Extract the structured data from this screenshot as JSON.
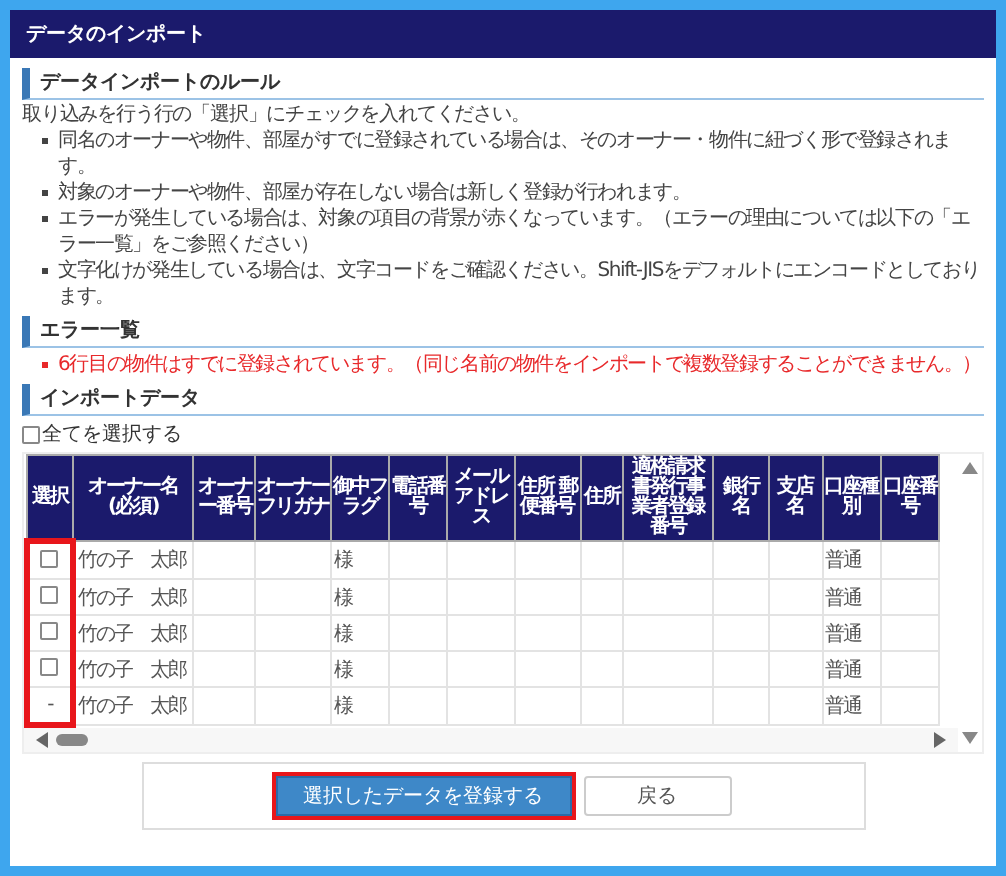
{
  "window": {
    "title": "データのインポート"
  },
  "rules": {
    "heading": "データインポートのルール",
    "intro": "取り込みを行う行の「選択」にチェックを入れてください。",
    "bullets": [
      "同名のオーナーや物件、部屋がすでに登録されている場合は、そのオーナー・物件に紐づく形で登録されます。",
      "対象のオーナーや物件、部屋が存在しない場合は新しく登録が行われます。",
      "エラーが発生している場合は、対象の項目の背景が赤くなっています。（エラーの理由については以下の「エラー一覧」をご参照ください）",
      "文字化けが発生している場合は、文字コードをご確認ください。Shift-JISをデフォルトにエンコードとしております。"
    ]
  },
  "errors": {
    "heading": "エラー一覧",
    "items": [
      "6行目の物件はすでに登録されています。（同じ名前の物件をインポートで複数登録することができません。）"
    ]
  },
  "import": {
    "heading": "インポートデータ",
    "select_all": {
      "label": "全てを選択する",
      "checked": false
    },
    "columns": [
      "選択",
      "オーナー名\n(必須)",
      "オーナー番号",
      "オーナーフリガナ",
      "御中フラグ",
      "電話番号",
      "メールアドレス",
      "住所 郵便番号",
      "住所",
      "適格請求書発行事業者登録番号",
      "銀行名",
      "支店名",
      "口座種別",
      "口座番号"
    ],
    "rows": [
      {
        "select": {
          "kind": "checkbox",
          "checked": false
        },
        "owner_name": "竹の子　太郎",
        "honorific": "様",
        "account_type": "普通"
      },
      {
        "select": {
          "kind": "checkbox",
          "checked": false
        },
        "owner_name": "竹の子　太郎",
        "honorific": "様",
        "account_type": "普通"
      },
      {
        "select": {
          "kind": "checkbox",
          "checked": false
        },
        "owner_name": "竹の子　太郎",
        "honorific": "様",
        "account_type": "普通"
      },
      {
        "select": {
          "kind": "checkbox",
          "checked": false
        },
        "owner_name": "竹の子　太郎",
        "honorific": "様",
        "account_type": "普通"
      },
      {
        "select": {
          "kind": "text",
          "text": "-"
        },
        "owner_name": "竹の子　太郎",
        "honorific": "様",
        "account_type": "普通"
      }
    ]
  },
  "buttons": {
    "register": "選択したデータを登録する",
    "back": "戻る"
  }
}
